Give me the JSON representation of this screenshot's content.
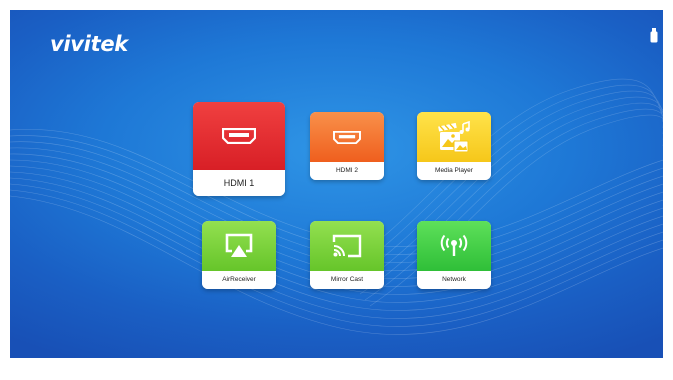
{
  "brand": {
    "logo_text": "vivitek"
  },
  "status_bar": {
    "usb_icon": "usb-stick-icon"
  },
  "tiles": [
    {
      "label": "HDMI 1",
      "icon": "hdmi-port-icon",
      "color": "#e02a2f"
    },
    {
      "label": "HDMI 2",
      "icon": "hdmi-port-icon",
      "color": "#f27a32"
    },
    {
      "label": "Media Player",
      "icon": "media-player-icon",
      "color": "#f9d22e"
    },
    {
      "label": "AirReceiver",
      "icon": "airplay-icon",
      "color": "#7fd23c"
    },
    {
      "label": "Mirror Cast",
      "icon": "cast-screen-icon",
      "color": "#7fd23c"
    },
    {
      "label": "Network",
      "icon": "wireless-antenna-icon",
      "color": "#3ccd45"
    }
  ],
  "colors": {
    "background": "#1e78d6",
    "tile_label_bg": "#ffffff"
  }
}
